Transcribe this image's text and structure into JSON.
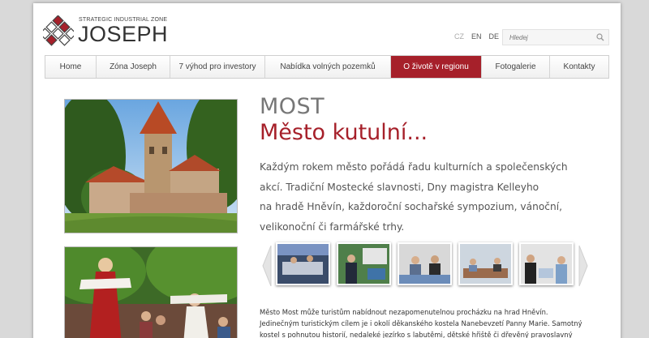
{
  "logo": {
    "subtitle": "STRATEGIC INDUSTRIAL ZONE",
    "name": "JOSEPH"
  },
  "languages": [
    {
      "code": "CZ",
      "active": false
    },
    {
      "code": "EN",
      "active": true
    },
    {
      "code": "DE",
      "active": true
    }
  ],
  "search": {
    "placeholder": "Hledej",
    "icon": "search-icon"
  },
  "nav": {
    "items": [
      {
        "label": "Home"
      },
      {
        "label": "Zóna Joseph"
      },
      {
        "label": "7 výhod pro investory"
      },
      {
        "label": "Nabídka volných pozemků"
      },
      {
        "label": "O životě v regionu",
        "active": true
      },
      {
        "label": "Fotogalerie"
      },
      {
        "label": "Kontakty"
      }
    ]
  },
  "content": {
    "heading_city": "MOST",
    "heading_tagline": "Město kutulní...",
    "lead_lines": [
      "Každým rokem město pořádá řadu kulturních a společenských",
      "akcí. Tradiční Mostecké slavnosti, Dny magistra Kelleyho",
      "na hradě Hněvín, každoroční sochařské sympozium, vánoční,",
      "velikonoční či farmářské trhy."
    ],
    "body_lines": [
      "Město Most může turistům nabídnout nezapomenutelnou procházku na hrad Hněvín.",
      "Jedinečným turistickým cílem je i okolí děkanského kostela Nanebevzetí Panny Marie. Samotný",
      "kostel s pohnutou historií, nedaleké jezírko s labutěmi, dětské hřiště či dřevěný pravoslavný"
    ]
  },
  "colors": {
    "accent": "#a6202a",
    "heading_gray": "#777777",
    "page_bg": "#d9d9d9"
  },
  "icons": {
    "prev": "chevron-left-icon",
    "next": "chevron-right-icon",
    "logo": "cube-logo-icon"
  }
}
